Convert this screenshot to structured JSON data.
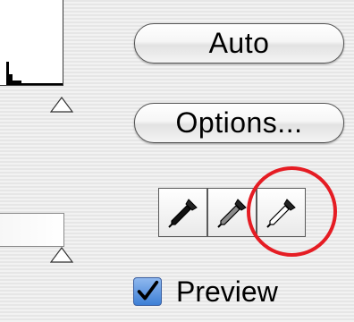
{
  "buttons": {
    "auto_label": "Auto",
    "options_label": "Options..."
  },
  "eyedroppers": [
    {
      "icon": "black-eyedropper-icon",
      "tone": "#111111"
    },
    {
      "icon": "gray-eyedropper-icon",
      "tone": "#8a8a8a"
    },
    {
      "icon": "white-eyedropper-icon",
      "tone": "#ffffff"
    }
  ],
  "preview": {
    "label": "Preview",
    "checked": true
  },
  "colors": {
    "highlight": "#e51c23",
    "checkbox_blue": "#3d7fd6"
  }
}
